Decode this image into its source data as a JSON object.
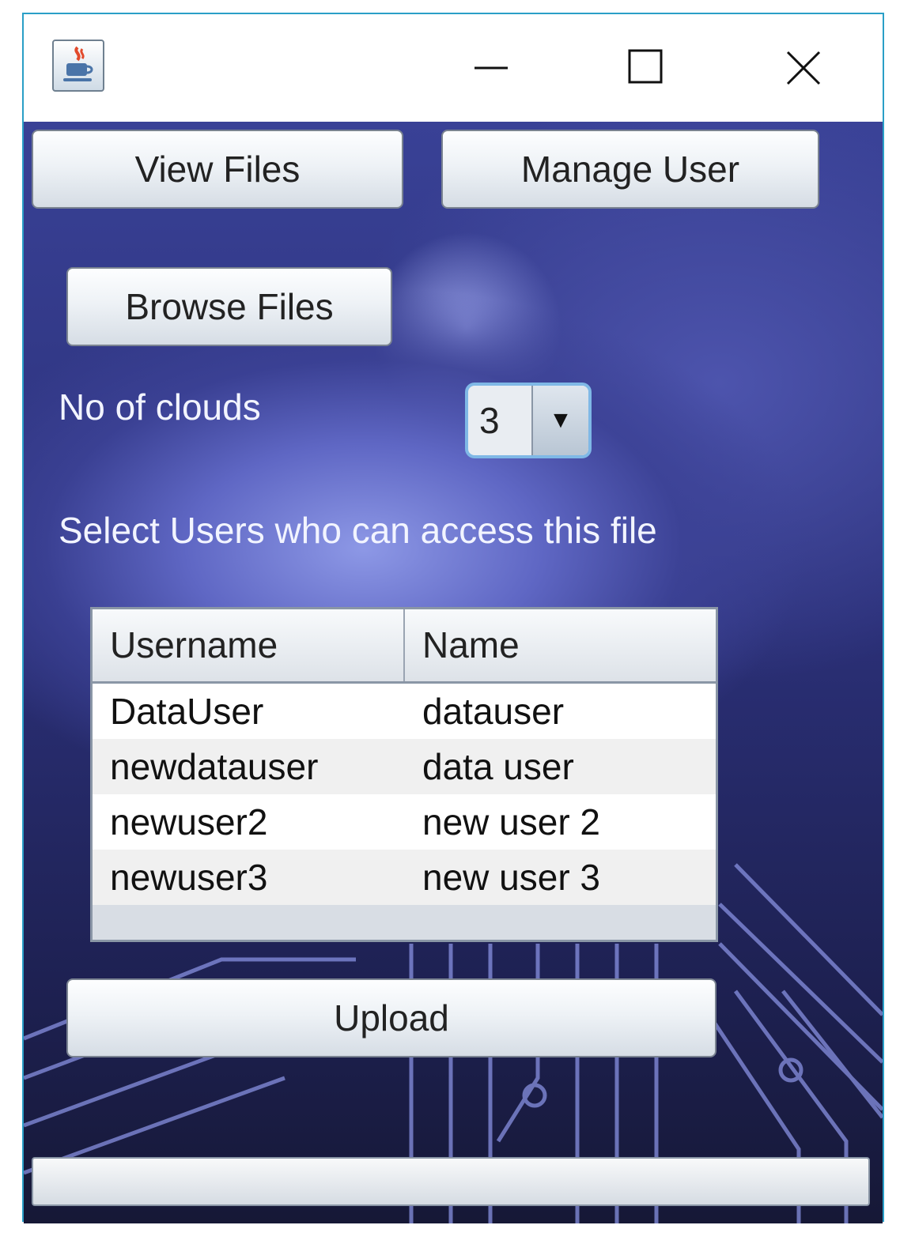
{
  "window": {
    "controls": {
      "minimize": "minimize-icon",
      "maximize": "maximize-icon",
      "close": "close-icon"
    },
    "app_icon": "java-cup-icon"
  },
  "toolbar": {
    "view_files_label": "View Files",
    "manage_user_label": "Manage User",
    "browse_files_label": "Browse Files"
  },
  "clouds": {
    "label": "No of clouds",
    "selected": "3"
  },
  "access": {
    "label": "Select Users who can access this file"
  },
  "users_table": {
    "columns": [
      "Username",
      "Name"
    ],
    "rows": [
      [
        "DataUser",
        "datauser"
      ],
      [
        "newdatauser",
        "data user"
      ],
      [
        "newuser2",
        "new user 2"
      ],
      [
        "newuser3",
        "new user 3"
      ]
    ]
  },
  "upload_label": "Upload",
  "progress": {
    "value": 0
  },
  "colors": {
    "window_border": "#2a9fc7",
    "combo_focus": "#7fb8e6",
    "background_dark": "#1d2050",
    "background_glow": "#8d98e6"
  }
}
